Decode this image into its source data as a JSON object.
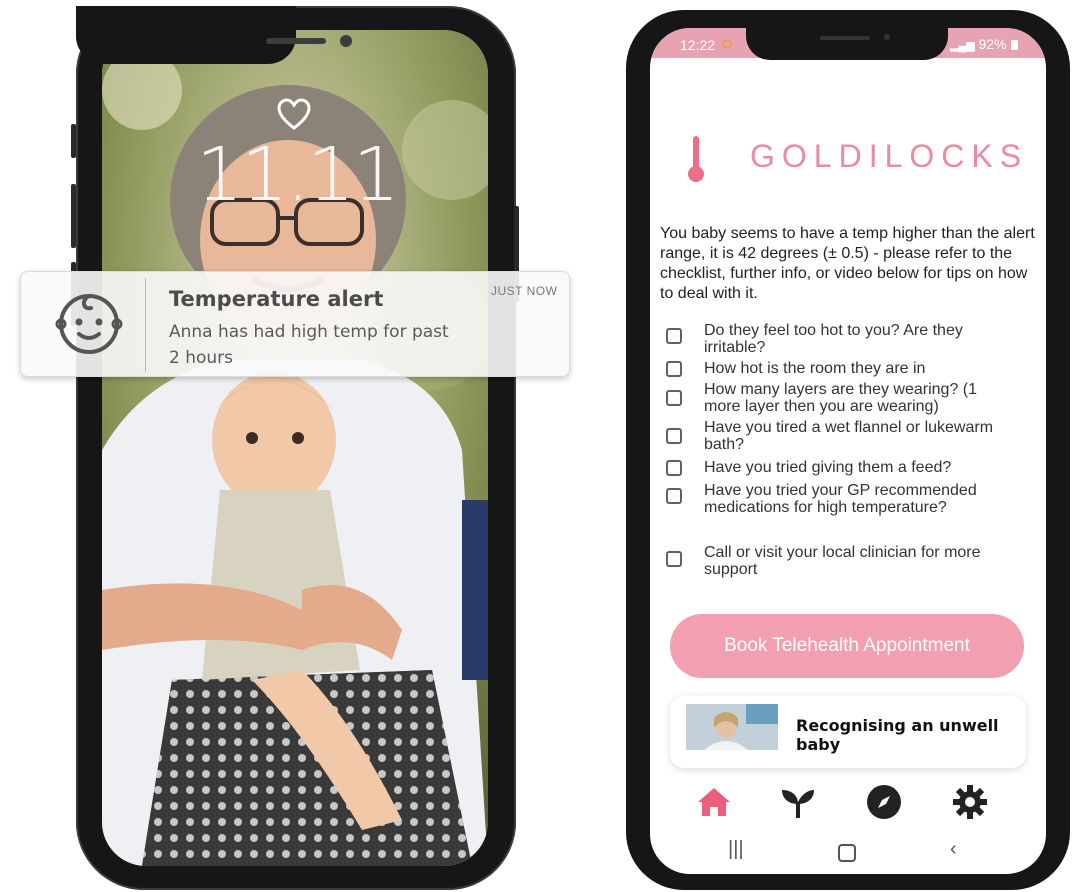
{
  "lock_screen": {
    "time": "11.11",
    "notification": {
      "title": "Temperature alert",
      "time_label": "JUST NOW",
      "body": "Anna has had high temp for past 2 hours",
      "icon": "baby-face-icon"
    }
  },
  "app": {
    "status_bar": {
      "time": "12:22",
      "battery": "92%"
    },
    "brand": "GOLDILOCKS",
    "message": "You baby seems to have a temp higher than the alert range, it is 42 degrees  (± 0.5) - please refer to the checklist, further info, or video below for tips on how to deal with it.",
    "checklist": [
      {
        "label": "Do they feel too hot to you? Are they irritable?"
      },
      {
        "label": "How hot is the room they are in"
      },
      {
        "label": "How many layers are they wearing? (1 more layer then you are wearing)"
      },
      {
        "label": "Have you tired a wet flannel or lukewarm bath?"
      },
      {
        "label": "Have you tried giving them a feed?"
      },
      {
        "label": "Have you tried your GP recommended medications for high temperature?"
      },
      {
        "label": "Call or visit your local clinician for more support"
      }
    ],
    "book_button": "Book Telehealth Appointment",
    "video_title": "Recognising an unwell baby",
    "nav_items": [
      "home-icon",
      "sprout-icon",
      "compass-icon",
      "gear-icon"
    ],
    "accent_color": "#f29fb1",
    "brand_color": "#ec8aa0"
  }
}
